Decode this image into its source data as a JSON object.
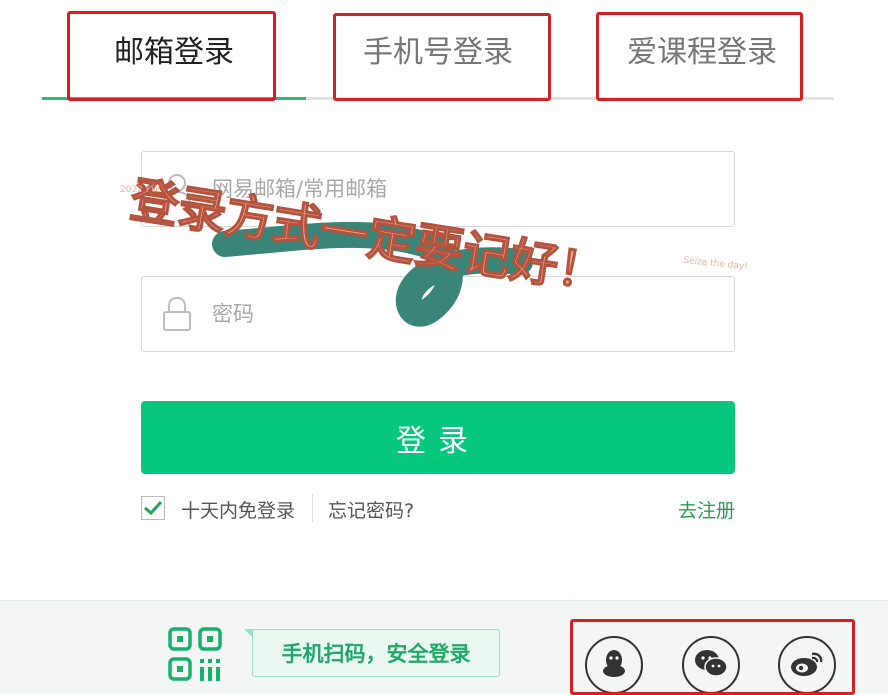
{
  "tabs": [
    {
      "label": "邮箱登录",
      "active": true
    },
    {
      "label": "手机号登录",
      "active": false
    },
    {
      "label": "爱课程登录",
      "active": false
    }
  ],
  "form": {
    "username_placeholder": "网易邮箱/常用邮箱",
    "password_placeholder": "密码",
    "login_label": "登录",
    "remember_label": "十天内免登录",
    "remember_checked": true,
    "forgot_label": "忘记密码?",
    "register_label": "去注册"
  },
  "bottom": {
    "qr_hint": "手机扫码，安全登录",
    "social": [
      "qq-icon",
      "wechat-icon",
      "weibo-icon"
    ]
  },
  "annotation": {
    "main": "登录方式一定要记好！",
    "tag_left": "2022 FW",
    "tag_right": "Seize the day!"
  },
  "colors": {
    "accent": "#05c87c",
    "tab_underline": "#2bbc7c",
    "link": "#2a9d56",
    "highlight_box": "#d81e1e",
    "annotation_text": "#f0a58c",
    "annotation_brush": "#2e7f72"
  }
}
